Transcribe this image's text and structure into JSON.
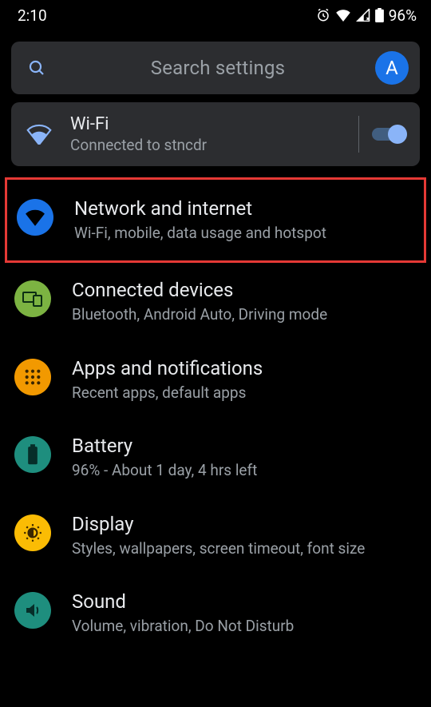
{
  "status": {
    "time": "2:10",
    "battery_pct": "96%"
  },
  "search": {
    "placeholder": "Search settings",
    "avatar_initial": "A"
  },
  "wifi_card": {
    "title": "Wi-Fi",
    "subtitle": "Connected to stncdr",
    "enabled": true
  },
  "rows": [
    {
      "id": "network",
      "title": "Network and internet",
      "subtitle": "Wi-Fi, mobile, data usage and hotspot",
      "highlighted": true
    },
    {
      "id": "connected-devices",
      "title": "Connected devices",
      "subtitle": "Bluetooth, Android Auto, Driving mode"
    },
    {
      "id": "apps",
      "title": "Apps and notifications",
      "subtitle": "Recent apps, default apps"
    },
    {
      "id": "battery",
      "title": "Battery",
      "subtitle": "96% - About 1 day, 4 hrs left"
    },
    {
      "id": "display",
      "title": "Display",
      "subtitle": "Styles, wallpapers, screen timeout, font size"
    },
    {
      "id": "sound",
      "title": "Sound",
      "subtitle": "Volume, vibration, Do Not Disturb"
    }
  ]
}
